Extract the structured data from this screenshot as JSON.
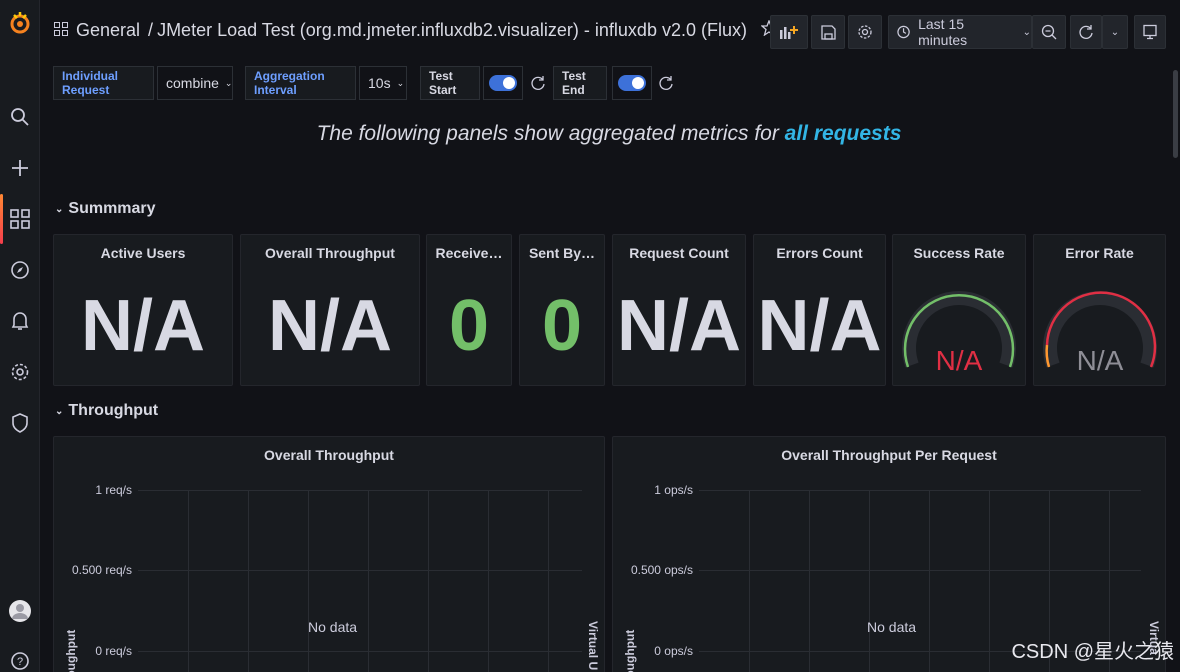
{
  "breadcrumb": {
    "folder": "General",
    "separator": "/",
    "title": "JMeter Load Test (org.md.jmeter.influxdb2.visualizer) - influxdb v2.0 (Flux)"
  },
  "toolbar": {
    "time_range": "Last 15 minutes"
  },
  "variables": {
    "individual_request_label": "Individual Request",
    "individual_request_value": "combine",
    "aggregation_label": "Aggregation Interval",
    "aggregation_value": "10s",
    "test_start_label": "Test Start",
    "test_end_label": "Test End"
  },
  "banner": {
    "prefix": "The following panels show aggregated metrics for ",
    "highlight": "all requests"
  },
  "rows": {
    "summary": "Summmary",
    "throughput": "Throughput"
  },
  "stats": [
    {
      "title": "Active Users",
      "value": "N/A"
    },
    {
      "title": "Overall Throughput",
      "value": "N/A"
    },
    {
      "title": "Receive…",
      "value": "0"
    },
    {
      "title": "Sent By…",
      "value": "0"
    },
    {
      "title": "Request Count",
      "value": "N/A"
    },
    {
      "title": "Errors Count",
      "value": "N/A"
    },
    {
      "title": "Success Rate",
      "value": "N/A"
    },
    {
      "title": "Error Rate",
      "value": "N/A"
    }
  ],
  "graphs": [
    {
      "title": "Overall Throughput",
      "ticks": [
        "1 req/s",
        "0.500 req/s",
        "0 req/s"
      ],
      "nodata": "No data",
      "left_axis": "Throughput",
      "right_axis": "Virtual U"
    },
    {
      "title": "Overall Throughput Per Request",
      "ticks": [
        "1 ops/s",
        "0.500 ops/s",
        "0 ops/s"
      ],
      "nodata": "No data",
      "left_axis": "Throughput",
      "right_axis": "Virtua"
    }
  ],
  "watermark": "CSDN @星火之猿",
  "colors": {
    "accent_blue": "#3d71d9",
    "stat_green": "#73bf69",
    "gauge_red": "#e02f44",
    "highlight": "#33b5e5"
  }
}
